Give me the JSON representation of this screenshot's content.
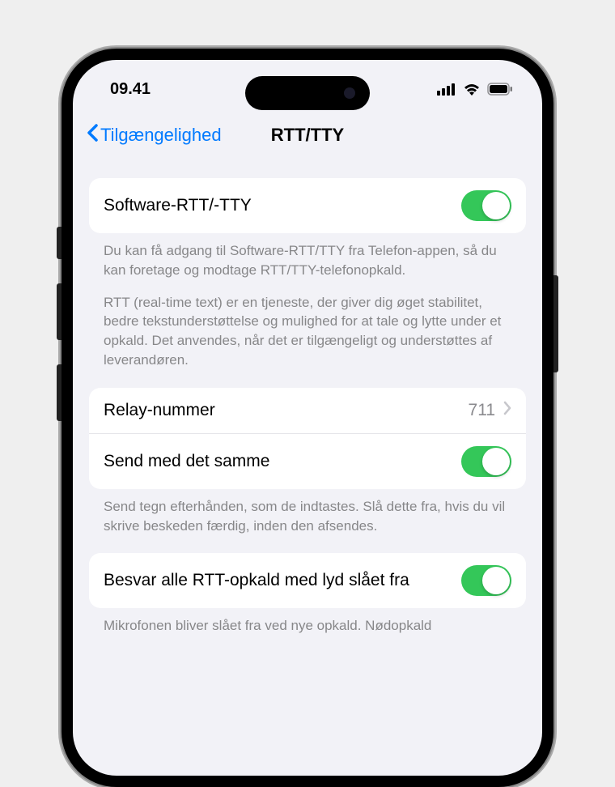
{
  "status_bar": {
    "time": "09.41"
  },
  "nav": {
    "back_label": "Tilgængelighed",
    "title": "RTT/TTY"
  },
  "groups": [
    {
      "cells": [
        {
          "label": "Software-RTT/-TTY",
          "toggle": true
        }
      ],
      "footer": [
        "Du kan få adgang til Software-RTT/TTY fra Telefon-appen, så du kan foretage og modtage RTT/TTY-telefonopkald.",
        "RTT (real-time text) er en tjeneste, der giver dig øget stabilitet, bedre tekstunderstøttelse og mulighed for at tale og lytte under et opkald. Det anvendes, når det er tilgængeligt og understøttes af leverandøren."
      ]
    },
    {
      "cells": [
        {
          "label": "Relay-nummer",
          "value": "711",
          "disclosure": true
        },
        {
          "label": "Send med det samme",
          "toggle": true
        }
      ],
      "footer": [
        "Send tegn efterhånden, som de indtastes. Slå dette fra, hvis du vil skrive beskeden færdig, inden den afsendes."
      ]
    },
    {
      "cells": [
        {
          "label": "Besvar alle RTT-opkald med lyd slået fra",
          "toggle": true
        }
      ],
      "footer": [
        "Mikrofonen bliver slået fra ved nye opkald. Nødopkald"
      ]
    }
  ]
}
